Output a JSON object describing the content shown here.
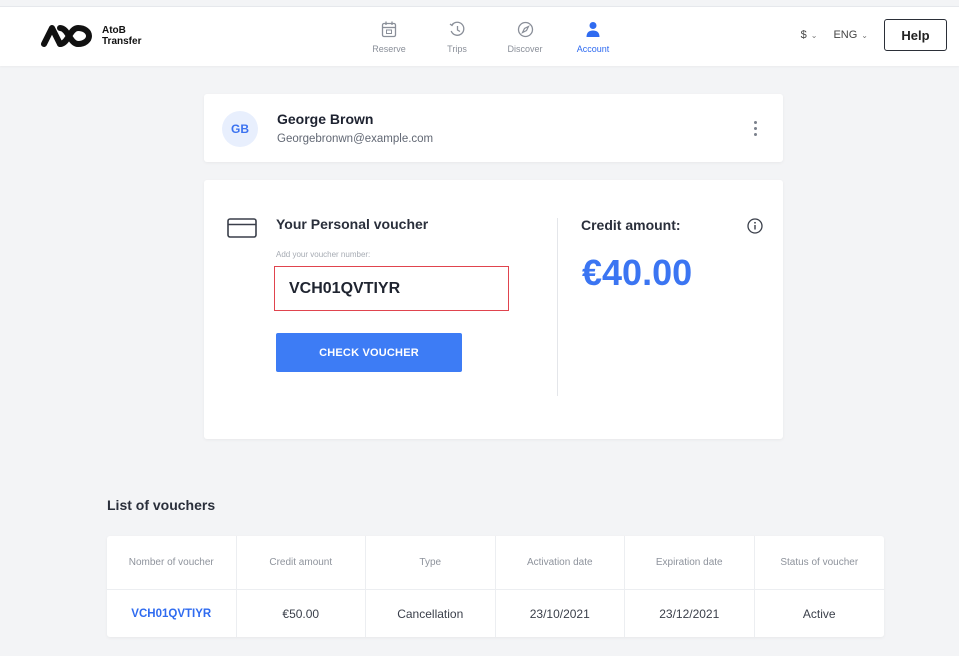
{
  "brand": {
    "line1": "AtoB",
    "line2": "Transfer"
  },
  "nav": [
    {
      "label": "Reserve",
      "icon": "calendar-icon",
      "active": false
    },
    {
      "label": "Trips",
      "icon": "history-icon",
      "active": false
    },
    {
      "label": "Discover",
      "icon": "compass-icon",
      "active": false
    },
    {
      "label": "Account",
      "icon": "user-icon",
      "active": true
    }
  ],
  "header": {
    "currency": "$",
    "language": "ENG",
    "help_label": "Help"
  },
  "profile": {
    "initials": "GB",
    "name": "George Brown",
    "email": "Georgebronwn@example.com"
  },
  "voucher": {
    "title": "Your Personal voucher",
    "hint": "Add your voucher number:",
    "input_value": "VCH01QVTIYR",
    "button_label": "CHECK VOUCHER",
    "credit_label": "Credit amount:",
    "credit_amount": "€40.00"
  },
  "list": {
    "title": "List of vouchers",
    "columns": [
      "Nomber of voucher",
      "Credit amount",
      "Type",
      "Activation date",
      "Expiration date",
      "Status of voucher"
    ],
    "rows": [
      [
        "VCH01QVTIYR",
        "€50.00",
        "Cancellation",
        "23/10/2021",
        "23/12/2021",
        "Active"
      ]
    ]
  },
  "colors": {
    "accent": "#3d7cf5",
    "error_border": "#e0444e",
    "background": "#f3f4f6"
  }
}
